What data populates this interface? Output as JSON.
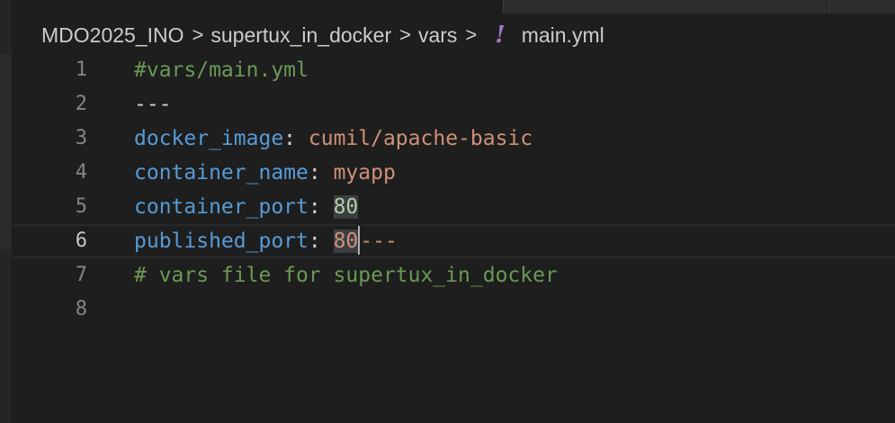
{
  "breadcrumb": {
    "items": [
      "MDO2025_INO",
      "supertux_in_docker",
      "vars"
    ],
    "separator": ">",
    "file_icon_glyph": "!",
    "file_name": "main.yml"
  },
  "editor": {
    "current_line": 6,
    "lines": [
      {
        "number": "1",
        "tokens": [
          {
            "t": "#vars/main.yml",
            "c": "comment"
          }
        ]
      },
      {
        "number": "2",
        "tokens": [
          {
            "t": "---",
            "c": "plain"
          }
        ]
      },
      {
        "number": "3",
        "tokens": [
          {
            "t": "docker_image",
            "c": "key"
          },
          {
            "t": ": ",
            "c": "punct"
          },
          {
            "t": "cumil/apache-basic",
            "c": "str"
          }
        ]
      },
      {
        "number": "4",
        "tokens": [
          {
            "t": "container_name",
            "c": "key"
          },
          {
            "t": ": ",
            "c": "punct"
          },
          {
            "t": "myapp",
            "c": "str"
          }
        ]
      },
      {
        "number": "5",
        "tokens": [
          {
            "t": "container_port",
            "c": "key"
          },
          {
            "t": ": ",
            "c": "punct"
          },
          {
            "t": "80",
            "c": "num",
            "hl": true
          }
        ]
      },
      {
        "number": "6",
        "tokens": [
          {
            "t": "published_port",
            "c": "key"
          },
          {
            "t": ": ",
            "c": "punct"
          },
          {
            "t": "80",
            "c": "str",
            "hl": true
          },
          {
            "cursor": true
          },
          {
            "t": "---",
            "c": "str"
          }
        ]
      },
      {
        "number": "7",
        "tokens": [
          {
            "t": "# vars file for supertux_in_docker",
            "c": "comment"
          }
        ]
      },
      {
        "number": "8",
        "tokens": []
      }
    ]
  },
  "colors": {
    "background": "#1e1e1e",
    "comment": "#6a9955",
    "key": "#569cd6",
    "string": "#ce9178",
    "number": "#b5cea8",
    "yaml_icon": "#a074c4"
  },
  "icons": {
    "file_type": "yaml-exclamation-icon",
    "breadcrumb_separator": "chevron-right-icon"
  }
}
